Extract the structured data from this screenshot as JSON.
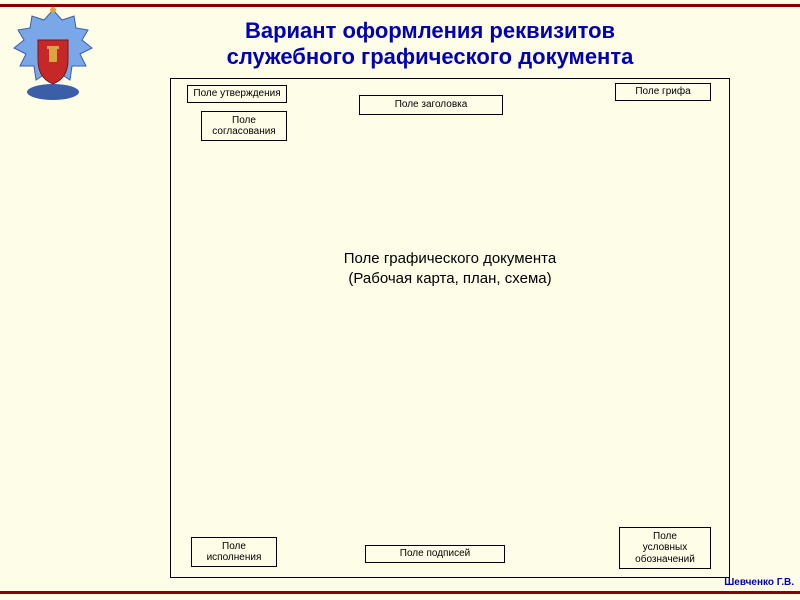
{
  "title_line1": "Вариант оформления реквизитов",
  "title_line2": "служебного графического документа",
  "boxes": {
    "approval": "Поле утверждения",
    "agreement": "Поле\nсогласования",
    "heading": "Поле заголовка",
    "classification": "Поле грифа",
    "main_line1": "Поле графического документа",
    "main_line2": "(Рабочая карта, план, схема)",
    "execution": "Поле\nисполнения",
    "signatures": "Поле подписей",
    "legend": "Поле\nусловных\nобозначений"
  },
  "author": "Шевченко Г.В."
}
